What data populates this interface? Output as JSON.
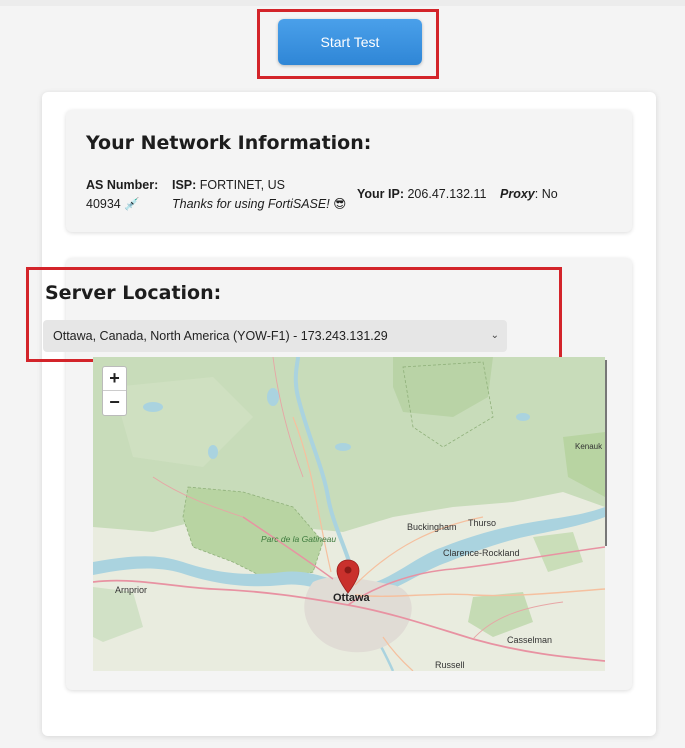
{
  "start_button_label": "Start Test",
  "network": {
    "title": "Your Network Information:",
    "as_label": "AS Number:",
    "as_value": "40934",
    "as_emoji": "💉",
    "isp_label": "ISP:",
    "isp_value": "FORTINET, US",
    "isp_note": "Thanks for using FortiSASE!",
    "isp_emoji": "😎",
    "ip_label": "Your IP:",
    "ip_value": "206.47.132.11",
    "proxy_label": "Proxy",
    "proxy_value": ": No"
  },
  "server": {
    "title": "Server Location:",
    "selected": "Ottawa, Canada, North America (YOW-F1) - 173.243.131.29"
  },
  "map": {
    "zoom_in": "+",
    "zoom_out": "−",
    "labels": {
      "ottawa": "Ottawa",
      "gatineau_park": "Parc de la Gatineau",
      "buckingham": "Buckingham",
      "thurso": "Thurso",
      "clarence_rockland": "Clarence-Rockland",
      "arnprior": "Arnprior",
      "casselman": "Casselman",
      "russell": "Russell",
      "kenauk": "Kenauk"
    },
    "pin_color": "#c9302c"
  }
}
